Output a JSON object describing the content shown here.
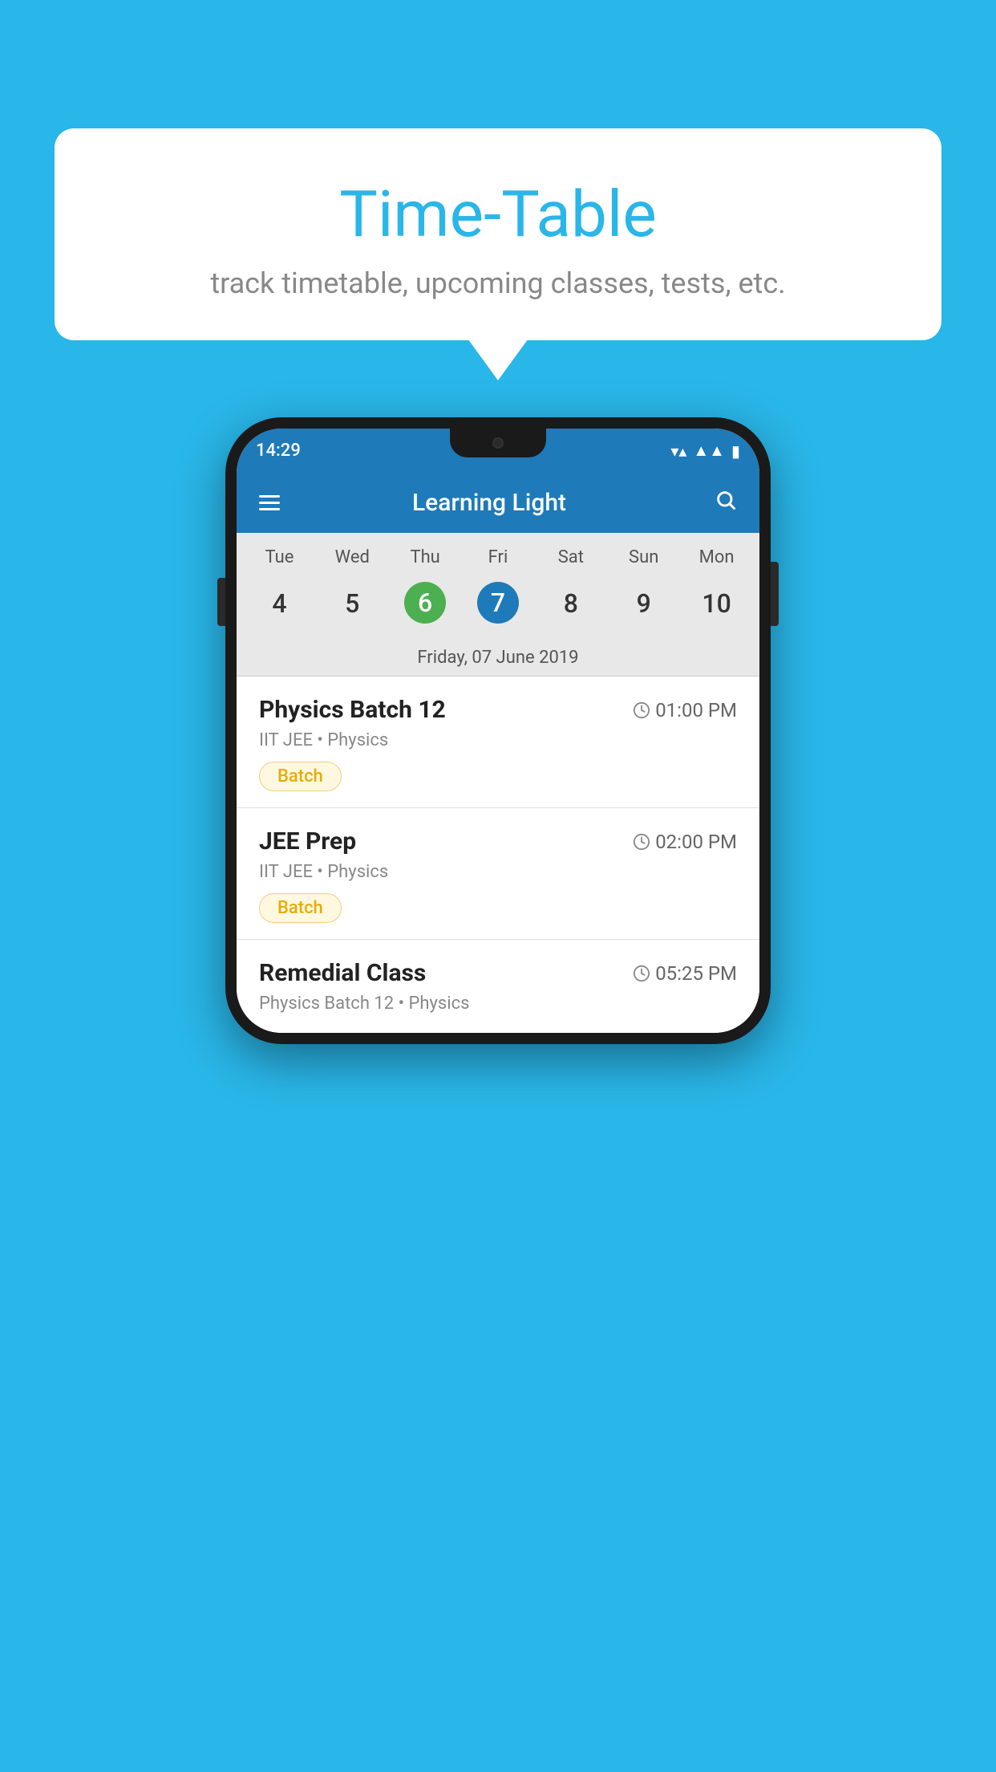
{
  "background_color": "#29b6e8",
  "bubble": {
    "title": "Time-Table",
    "subtitle": "track timetable, upcoming classes, tests, etc."
  },
  "phone": {
    "status_bar": {
      "time": "14:29",
      "icons": [
        "wifi",
        "signal",
        "battery"
      ]
    },
    "app_bar": {
      "title": "Learning Light",
      "menu_label": "menu",
      "search_label": "search"
    },
    "calendar": {
      "days": [
        "Tue",
        "Wed",
        "Thu",
        "Fri",
        "Sat",
        "Sun",
        "Mon"
      ],
      "dates": [
        "4",
        "5",
        "6",
        "7",
        "8",
        "9",
        "10"
      ],
      "today_index": 2,
      "selected_index": 3,
      "selected_date_label": "Friday, 07 June 2019"
    },
    "schedule": [
      {
        "title": "Physics Batch 12",
        "time": "01:00 PM",
        "subject": "IIT JEE • Physics",
        "badge": "Batch"
      },
      {
        "title": "JEE Prep",
        "time": "02:00 PM",
        "subject": "IIT JEE • Physics",
        "badge": "Batch"
      },
      {
        "title": "Remedial Class",
        "time": "05:25 PM",
        "subject": "Physics Batch 12 • Physics",
        "badge": null
      }
    ]
  }
}
